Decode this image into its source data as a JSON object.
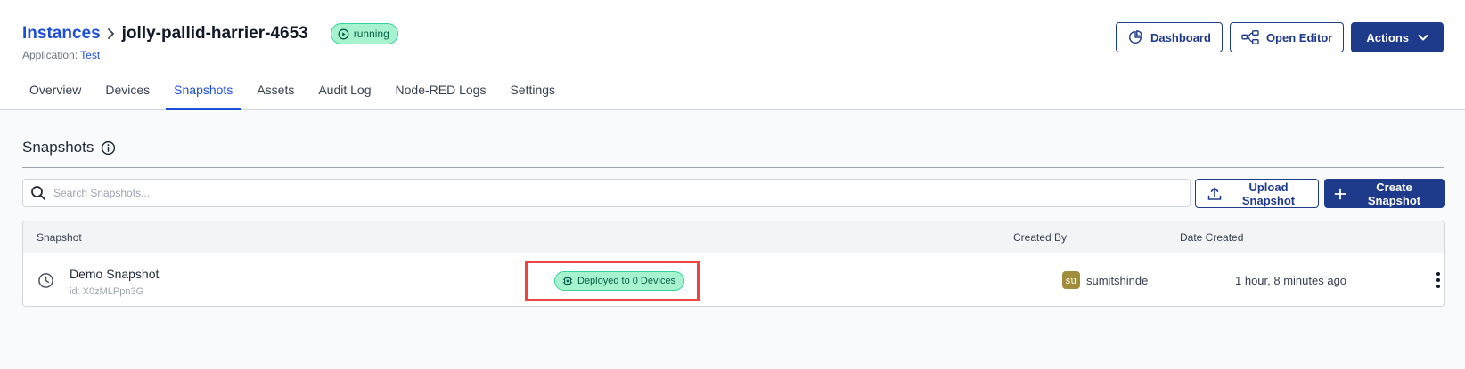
{
  "header": {
    "breadcrumb_link": "Instances",
    "instance_name": "jolly-pallid-harrier-4653",
    "status": "running",
    "application_label": "Application:",
    "application_name": "Test",
    "buttons": {
      "dashboard": "Dashboard",
      "open_editor": "Open Editor",
      "actions": "Actions"
    }
  },
  "tabs": [
    {
      "label": "Overview",
      "active": false
    },
    {
      "label": "Devices",
      "active": false
    },
    {
      "label": "Snapshots",
      "active": true
    },
    {
      "label": "Assets",
      "active": false
    },
    {
      "label": "Audit Log",
      "active": false
    },
    {
      "label": "Node-RED Logs",
      "active": false
    },
    {
      "label": "Settings",
      "active": false
    }
  ],
  "section": {
    "title": "Snapshots"
  },
  "search": {
    "placeholder": "Search Snapshots...",
    "value": ""
  },
  "toolbar": {
    "upload_label": "Upload Snapshot",
    "create_label": "Create Snapshot"
  },
  "table": {
    "headers": {
      "snapshot": "Snapshot",
      "created_by": "Created By",
      "date_created": "Date Created"
    },
    "rows": [
      {
        "name": "Demo Snapshot",
        "id": "id: X0zMLPpn3G",
        "deployed": "Deployed to 0 Devices",
        "avatar_initials": "su",
        "created_by": "sumitshinde",
        "date_created": "1 hour, 8 minutes ago"
      }
    ]
  },
  "colors": {
    "primary": "#1e3a8a",
    "link": "#1d4ed8",
    "status_bg": "#a7f3d0",
    "highlight": "#ef4444"
  },
  "icons": {
    "status": "play-circle-icon",
    "dashboard": "chart-pie-icon",
    "open_editor": "node-flow-icon",
    "actions": "chevron-down-icon",
    "info": "info-circle-icon",
    "search": "search-icon",
    "upload": "upload-icon",
    "create": "plus-icon",
    "snapshot_row": "clock-icon",
    "deploy": "chip-icon",
    "row_menu": "kebab-menu-icon"
  }
}
